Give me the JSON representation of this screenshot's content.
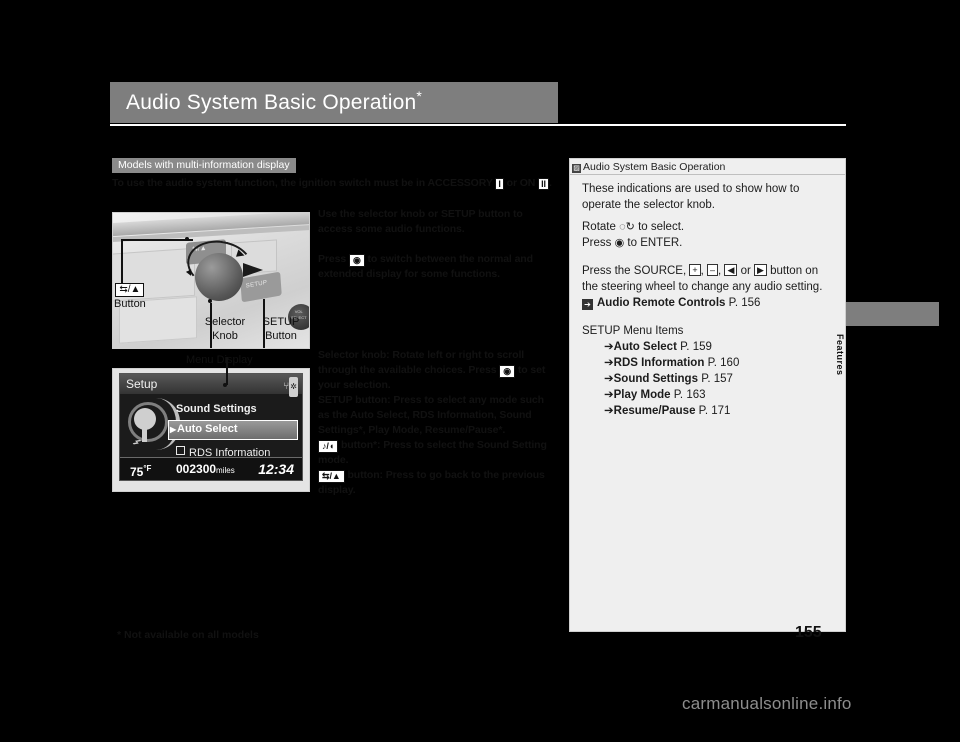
{
  "page": {
    "title": "Audio System Basic Operation",
    "title_asterisk": "*",
    "footnote": "* Not available on all models",
    "page_number": "155",
    "side_tab_label": "Features",
    "watermark": "carmanualsonline.info"
  },
  "left": {
    "badge": "Models with multi-information display",
    "intro_1": "To use the audio system function, the ignition switch must be in ACCESSORY",
    "intro_key_1": "I",
    "intro_2": "or ON",
    "intro_key_2": "II",
    "intro_3": ".",
    "photo": {
      "back_button_label_line1": "⇆/▲",
      "back_button_label_line2": "Button",
      "selector_knob_label_line1": "Selector",
      "selector_knob_label_line2": "Knob",
      "setup_button_label_line1": "SETUP",
      "setup_button_label_line2": "Button",
      "knob_face_text": "VOL SELECT",
      "setup_face_text": "SETUP",
      "back_face_text": "⇆/▲"
    },
    "display": {
      "callout": "Menu Display",
      "title": "Setup",
      "rows": [
        {
          "label": "Sound Settings",
          "state": "plain"
        },
        {
          "label": "Auto Select",
          "state": "highlighted"
        },
        {
          "label": "RDS Information",
          "state": "checkbox"
        }
      ],
      "status": {
        "temperature": "75",
        "temperature_unit": "°F",
        "odometer": "002300",
        "odometer_unit": "miles",
        "clock": "12:34"
      }
    }
  },
  "middle": {
    "para_1": "Use the selector knob or SETUP button to access some audio functions.",
    "para_2_a": "Press",
    "para_2_b": "to switch between the normal and extended display for some functions.",
    "para_3_a": "Selector knob: Rotate left or right to scroll through the available choices. Press",
    "para_3_b": "to set your selection.",
    "para_4": "SETUP button: Press to select any mode such as the Auto Select, RDS Information, Sound Settings*, Play Mode, Resume/Pause*.",
    "para_5_icon": "♪/◖",
    "para_5": "button*: Press to select the Sound Setting mode.",
    "para_6_icon": "⇆/▲",
    "para_6": "button: Press to go back to the previous display."
  },
  "info": {
    "header": "Audio System Basic Operation",
    "line_1": "These indications are used to show how to operate the selector knob.",
    "rotate_pre": "Rotate",
    "rotate_post": "to select.",
    "press_pre": "Press",
    "press_post": "to ENTER.",
    "source_pre": "Press the SOURCE,",
    "source_keys": [
      "+",
      "–",
      "◀",
      "▶"
    ],
    "source_mid": "or",
    "source_post": "button on the steering wheel to change any audio setting.",
    "ref_audio_remote": {
      "label": "Audio Remote Controls",
      "page": "P. 156"
    },
    "setup_menu_heading": "SETUP Menu Items",
    "setup_items": [
      {
        "label": "Auto Select",
        "page": "P. 159"
      },
      {
        "label": "RDS Information",
        "page": "P. 160"
      },
      {
        "label": "Sound Settings",
        "page": "P. 157"
      },
      {
        "label": "Play Mode",
        "page": "P. 163"
      },
      {
        "label": "Resume/Pause",
        "page": "P. 171"
      }
    ]
  },
  "colors": {
    "header_band": "#7e7e7e",
    "badge": "#8a8a8a",
    "info_panel": "#efefef",
    "page_bg": "#000000"
  }
}
